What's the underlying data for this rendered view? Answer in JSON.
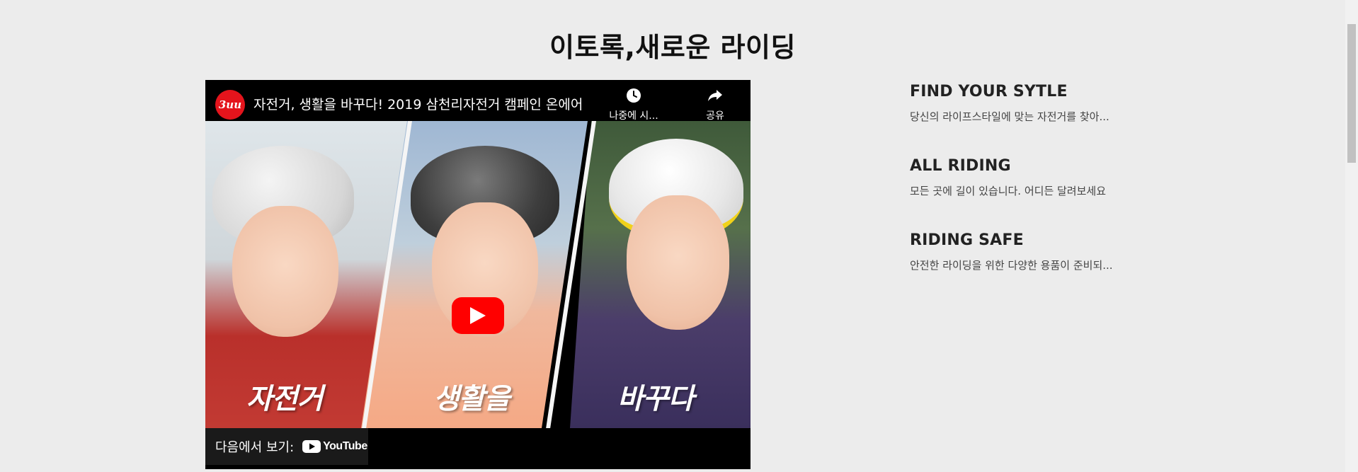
{
  "page": {
    "title": "이토록,새로운 라이딩"
  },
  "video": {
    "channel_logo": "3uu",
    "title": "자전거, 생활을 바꾸다! 2019 삼천리자전거 캠페인 온에어",
    "watch_later_label": "나중에 시...",
    "share_label": "공유",
    "watch_on_label": "다음에서 보기:",
    "youtube_logo_text": "YouTube",
    "thumbnail_captions": [
      "자전거",
      "생활을",
      "바꾸다"
    ],
    "icons": {
      "watch_later": "clock-icon",
      "share": "share-arrow-icon",
      "play": "play-icon",
      "youtube": "youtube-logo-icon"
    },
    "colors": {
      "play_button": "#ff0000",
      "channel_logo_bg": "#e4141c"
    }
  },
  "features": [
    {
      "title": "FIND YOUR SYTLE",
      "description": "당신의 라이프스타일에 맞는 자전거를 찾아..."
    },
    {
      "title": "ALL RIDING",
      "description": "모든 곳에 길이 있습니다. 어디든 달려보세요"
    },
    {
      "title": "RIDING SAFE",
      "description": "안전한 라이딩을 위한 다양한 용품이 준비되..."
    }
  ],
  "colors": {
    "background": "#ececec"
  }
}
